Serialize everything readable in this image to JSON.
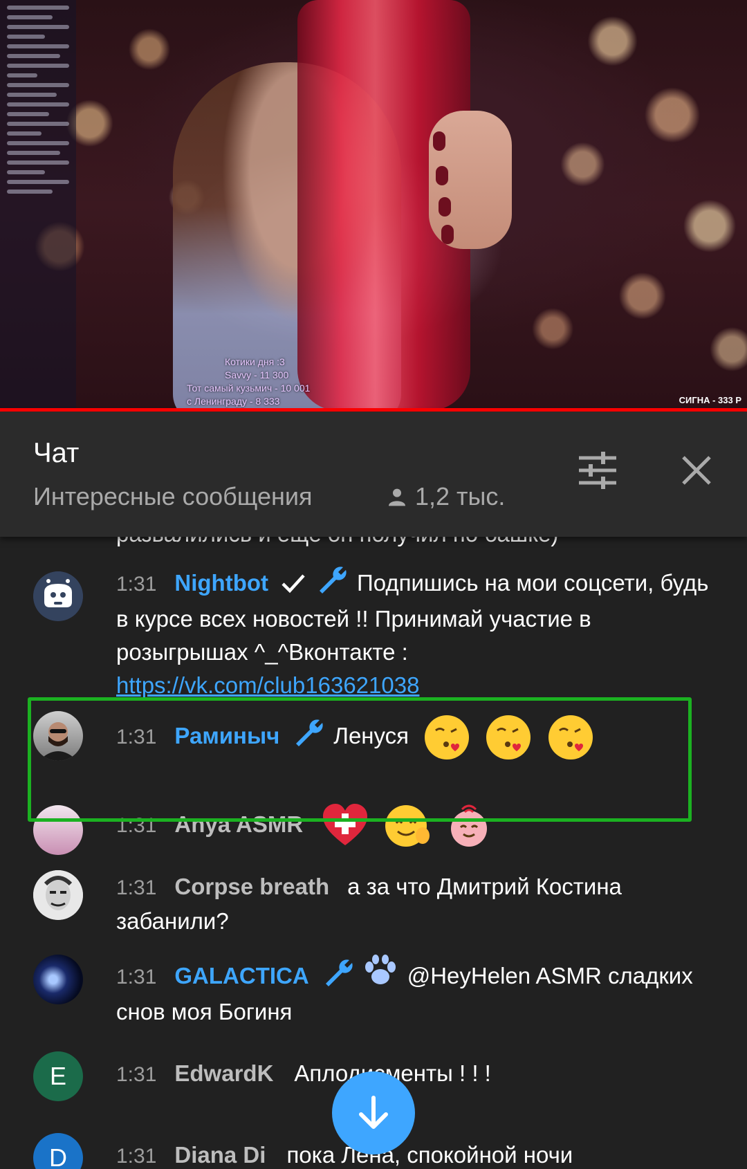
{
  "video": {
    "overlay_lines": [
      "Котики дня :3",
      "Savvy - 11 300",
      "Тот самый кузьмич - 10 001",
      "с Ленинграду - 8 333"
    ],
    "corner_text": "СИГНА - 333 Р"
  },
  "chat_header": {
    "title": "Чат",
    "filter_label": "Интересные сообщения",
    "viewer_count": "1,2 тыс.",
    "icons": {
      "settings": "tune-icon",
      "close": "close-icon",
      "viewers": "person-icon"
    }
  },
  "messages": [
    {
      "partial_text": "развалились и ещё он получил по башке)"
    },
    {
      "time": "1:31",
      "author": "Nightbot",
      "verified": true,
      "moderator": true,
      "text": "Подпишись на мои соцсети, будь в курсе всех новостей !! Принимай участие в розыгрышах ^_^Вконтакте :",
      "link": "https://vk.com/club163621038"
    },
    {
      "time": "1:31",
      "author": "Раминыч",
      "moderator": true,
      "text": "Ленуся",
      "emojis": [
        "kissing-heart",
        "kissing-heart",
        "kissing-heart"
      ]
    },
    {
      "time": "1:31",
      "author": "Anya ASMR",
      "emojis": [
        "red-heart-cross",
        "smile-wave",
        "hug-face"
      ]
    },
    {
      "time": "1:31",
      "author": "Corpse breath",
      "text": "а за что Дмитрий Костина забанили?"
    },
    {
      "time": "1:31",
      "author": "GALACTICA",
      "moderator": true,
      "paw_badge": true,
      "text": "@HeyHelen ASMR сладких снов моя Богиня"
    },
    {
      "time": "1:31",
      "author": "EdwardK",
      "avatar_letter": "E",
      "avatar_color": "#1b6b4a",
      "text": "Аплодисменты ! ! !"
    },
    {
      "time": "1:31",
      "author": "Diana Di",
      "avatar_letter": "D",
      "avatar_color": "#1a73c8",
      "text": "пока Лена, спокойной ночи"
    }
  ],
  "colors": {
    "moderator_name": "#3ea6ff",
    "highlight_border": "#1bb121",
    "progress": "#ff0000",
    "fab": "#3ea6ff"
  }
}
